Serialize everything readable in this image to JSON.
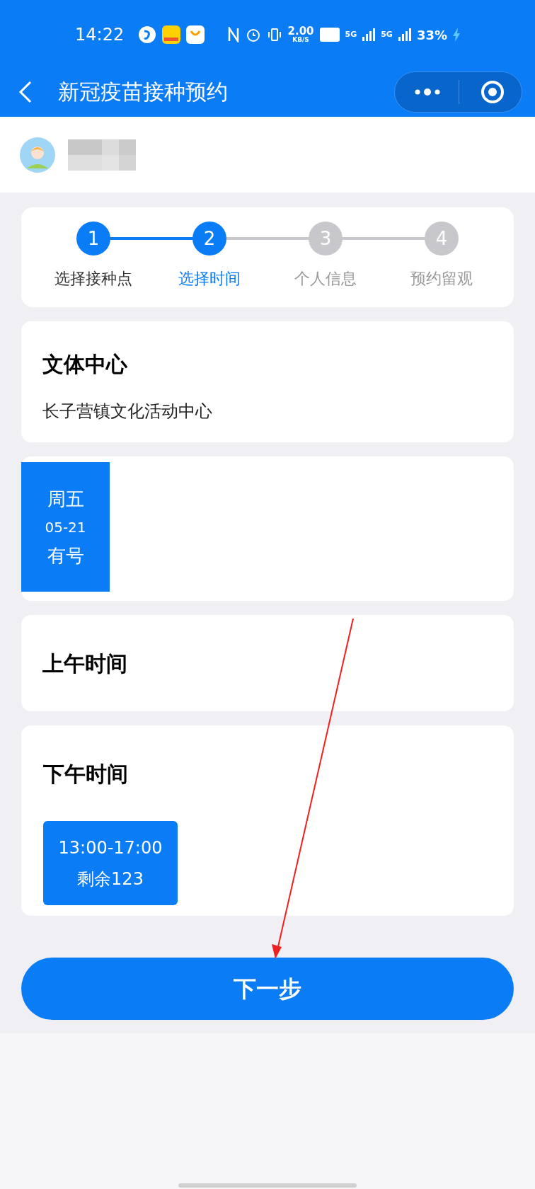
{
  "status_bar": {
    "time": "14:22",
    "speed_value": "2.00",
    "speed_unit": "KB/S",
    "network_1": "5G",
    "network_2": "5G",
    "battery": "33%"
  },
  "nav_bar": {
    "title": "新冠疫苗接种预约"
  },
  "steps": [
    {
      "number": "1",
      "label": "选择接种点",
      "reached": true,
      "selected": false
    },
    {
      "number": "2",
      "label": "选择时间",
      "reached": true,
      "selected": true
    },
    {
      "number": "3",
      "label": "个人信息",
      "reached": false,
      "selected": false
    },
    {
      "number": "4",
      "label": "预约留观",
      "reached": false,
      "selected": false
    }
  ],
  "site": {
    "name": "文体中心",
    "address": "长子营镇文化活动中心"
  },
  "dates": [
    {
      "weekday": "周五",
      "date": "05-21",
      "availability": "有号",
      "selected": true
    }
  ],
  "morning": {
    "title": "上午时间"
  },
  "afternoon": {
    "title": "下午时间",
    "slots": [
      {
        "time": "13:00-17:00",
        "remaining": "剩余123",
        "selected": true
      }
    ]
  },
  "next_button": {
    "label": "下一步"
  }
}
